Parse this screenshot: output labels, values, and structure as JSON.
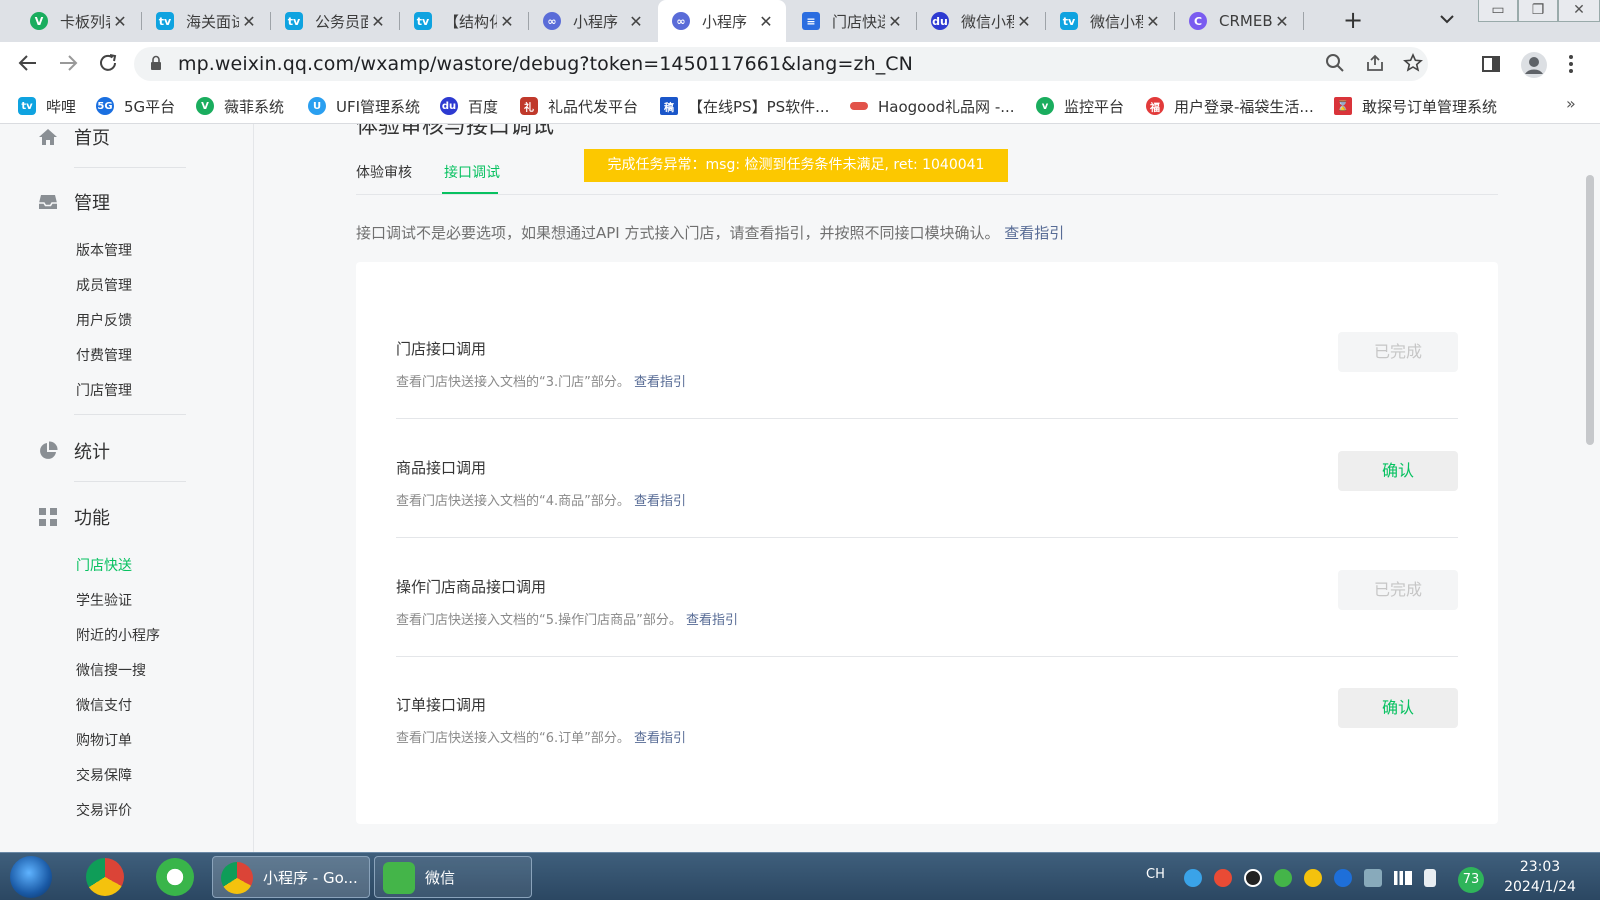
{
  "browser": {
    "tabs": [
      {
        "title": "卡板列表",
        "icon": "weifei-icon",
        "color": "#1aad5e"
      },
      {
        "title": "海关面试",
        "icon": "bilibili-icon",
        "color": "#0fa3e0"
      },
      {
        "title": "公务员面",
        "icon": "bilibili-icon",
        "color": "#0fa3e0"
      },
      {
        "title": "【结构化",
        "icon": "bilibili-icon",
        "color": "#0fa3e0"
      },
      {
        "title": "小程序",
        "icon": "miniprogram-icon",
        "color": "#5a6cd8"
      },
      {
        "title": "小程序",
        "icon": "miniprogram-icon",
        "color": "#5a6cd8",
        "active": true
      },
      {
        "title": "门店快送",
        "icon": "doc-icon",
        "color": "#2b6de0"
      },
      {
        "title": "微信小程",
        "icon": "baidu-icon",
        "color": "#2d3ad1"
      },
      {
        "title": "微信小程",
        "icon": "bilibili-icon",
        "color": "#0fa3e0"
      },
      {
        "title": "CRMEB",
        "icon": "crmeb-icon",
        "color": "#7a5cf0"
      }
    ],
    "close_glyph": "✕",
    "new_tab_glyph": "+",
    "url": "mp.weixin.qq.com/wxamp/wastore/debug?token=1450117661&lang=zh_CN",
    "bookmarks": [
      {
        "label": "哔哩",
        "color": "#0fa3e0"
      },
      {
        "label": "5G平台",
        "color": "#1a6fe0"
      },
      {
        "label": "薇菲系统",
        "color": "#1aad5e"
      },
      {
        "label": "UFI管理系统",
        "color": "#2a9ff0"
      },
      {
        "label": "百度",
        "color": "#2d3ad1"
      },
      {
        "label": "礼品代发平台",
        "color": "#c0392b"
      },
      {
        "label": "【在线PS】PS软件...",
        "color": "#1a56c9"
      },
      {
        "label": "Haogood礼品网 -...",
        "color": "#e2534a"
      },
      {
        "label": "监控平台",
        "color": "#1aad5e"
      },
      {
        "label": "用户登录-福袋生活...",
        "color": "#e23a3a"
      },
      {
        "label": "敢探号订单管理系统",
        "color": "#d9343a"
      }
    ],
    "bookmarks_more": "»"
  },
  "sidebar": {
    "groups": [
      {
        "label": "首页",
        "icon": "home-icon"
      },
      {
        "label": "管理",
        "icon": "inbox-icon"
      },
      {
        "label": "统计",
        "icon": "pie-chart-icon"
      },
      {
        "label": "功能",
        "icon": "grid-icon"
      }
    ],
    "manage_items": [
      "版本管理",
      "成员管理",
      "用户反馈",
      "付费管理",
      "门店管理"
    ],
    "feature_items": [
      "门店快送",
      "学生验证",
      "附近的小程序",
      "微信搜一搜",
      "微信支付",
      "购物订单",
      "交易保障",
      "交易评价"
    ]
  },
  "main": {
    "page_title": "体验审核与接口调试",
    "tabs": [
      "体验审核",
      "接口调试"
    ],
    "toast": "完成任务异常：msg: 检测到任务条件未满足, ret: 1040041",
    "intro": "接口调试不是必要选项，如果想通过API 方式接入门店，请查看指引，并按照不同接口模块确认。",
    "intro_link": "查看指引",
    "rows": [
      {
        "title": "门店接口调用",
        "desc": "查看门店快送接入文档的“3.门店”部分。",
        "link": "查看指引",
        "button": "已完成",
        "state": "done"
      },
      {
        "title": "商品接口调用",
        "desc": "查看门店快送接入文档的“4.商品”部分。",
        "link": "查看指引",
        "button": "确认",
        "state": "confirm"
      },
      {
        "title": "操作门店商品接口调用",
        "desc": "查看门店快送接入文档的“5.操作门店商品”部分。",
        "link": "查看指引",
        "button": "已完成",
        "state": "done"
      },
      {
        "title": "订单接口调用",
        "desc": "查看门店快送接入文档的“6.订单”部分。",
        "link": "查看指引",
        "button": "确认",
        "state": "confirm"
      }
    ]
  },
  "taskbar": {
    "tasks": [
      {
        "label": "小程序 - Go...",
        "icon": "chrome-icon"
      },
      {
        "label": "微信",
        "icon": "wechat-icon"
      }
    ],
    "ime": "CH",
    "battery": "73",
    "time": "23:03",
    "date": "2024/1/24"
  },
  "colors": {
    "accent": "#07c160",
    "link": "#576b95",
    "toast": "#fcc800"
  }
}
